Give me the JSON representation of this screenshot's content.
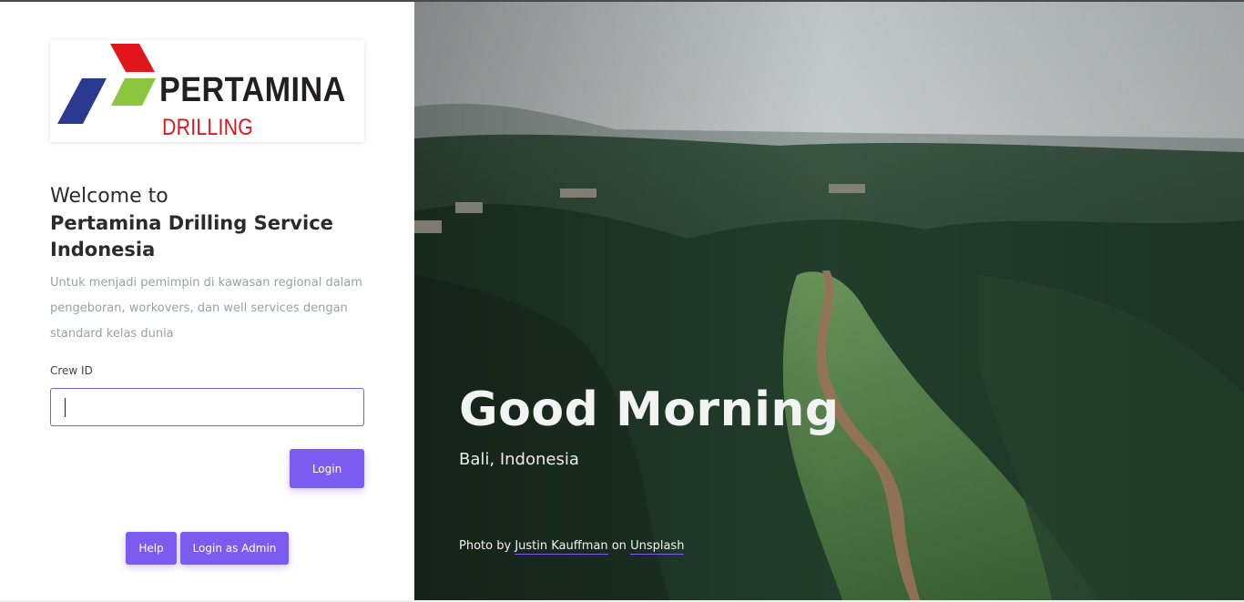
{
  "logo": {
    "wordmark": "PERTAMINA",
    "subline": "DRILLING",
    "colors": {
      "red": "#e1161d",
      "green": "#8cc63f",
      "blue": "#2b3990"
    }
  },
  "intro": {
    "welcome": "Welcome to",
    "company": "Pertamina Drilling Service Indonesia",
    "tagline": "Untuk menjadi pemimpin di kawasan regional dalam pengeboran, workovers, dan well services dengan standard kelas dunia"
  },
  "form": {
    "crew_label": "Crew ID",
    "crew_value": "",
    "login_label": "Login"
  },
  "footer_buttons": {
    "help_label": "Help",
    "admin_label": "Login as Admin"
  },
  "hero": {
    "greeting": "Good Morning",
    "location": "Bali, Indonesia",
    "credit_prefix": "Photo by",
    "photographer": "Justin Kauffman",
    "credit_mid": "on",
    "source": "Unsplash"
  },
  "colors": {
    "accent": "#7c5cf0",
    "text_dark": "#2b2b2b",
    "text_muted": "#9aa0a6"
  }
}
